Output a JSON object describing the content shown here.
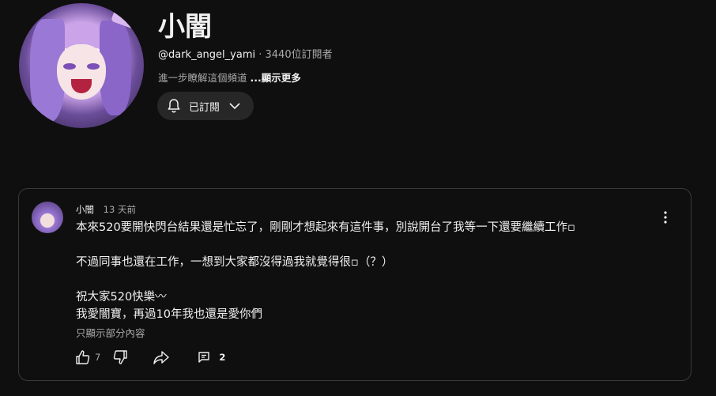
{
  "channel": {
    "name": "小闇",
    "handle": "@dark_angel_yami",
    "separator": "‧",
    "subscribers": "3440位訂閱者",
    "about": "進一步瞭解這個頻道",
    "about_more": "...顯示更多",
    "subscribe_label": "已訂閱"
  },
  "post": {
    "author": "小闇",
    "time": "13 天前",
    "lines": [
      "本來520要開快閃台結果還是忙忘了，剛剛才想起來有這件事，別說開台了我等一下還要繼續工作▫",
      "不過同事也還在工作，一想到大家都沒得過我就覺得很▫（？）",
      "祝大家520快樂〰",
      "我愛闇寶，再過10年我也還是愛你們"
    ],
    "show_partial": "只顯示部分內容",
    "like_count": "7",
    "comment_count": "2"
  }
}
